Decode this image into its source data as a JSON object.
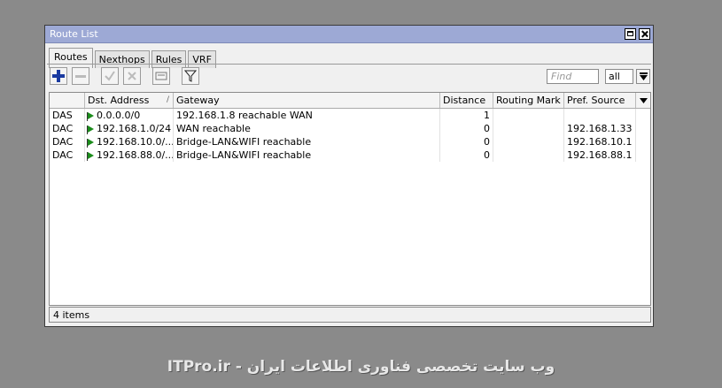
{
  "window": {
    "title": "Route List"
  },
  "tabs": [
    {
      "label": "Routes"
    },
    {
      "label": "Nexthops"
    },
    {
      "label": "Rules"
    },
    {
      "label": "VRF"
    }
  ],
  "toolbar": {
    "find_placeholder": "Find",
    "filter_value": "all"
  },
  "table": {
    "columns": [
      "",
      "Dst. Address",
      "Gateway",
      "Distance",
      "Routing Mark",
      "Pref. Source"
    ],
    "rows": [
      {
        "flags": "DAS",
        "dst": "0.0.0.0/0",
        "gateway": "192.168.1.8 reachable WAN",
        "distance": "1",
        "routing_mark": "",
        "pref_source": ""
      },
      {
        "flags": "DAC",
        "dst": "192.168.1.0/24",
        "gateway": "WAN reachable",
        "distance": "0",
        "routing_mark": "",
        "pref_source": "192.168.1.33"
      },
      {
        "flags": "DAC",
        "dst": "192.168.10.0/...",
        "gateway": "Bridge-LAN&WIFI reachable",
        "distance": "0",
        "routing_mark": "",
        "pref_source": "192.168.10.1"
      },
      {
        "flags": "DAC",
        "dst": "192.168.88.0/...",
        "gateway": "Bridge-LAN&WIFI reachable",
        "distance": "0",
        "routing_mark": "",
        "pref_source": "192.168.88.1"
      }
    ]
  },
  "status": {
    "count": "4 items"
  },
  "watermark": "ITPro.ir - وب سایت تخصصی فناوری اطلاعات ایران",
  "colors": {
    "titlebar": "#9da9d5",
    "flag": "#1b8c1b",
    "add_icon": "#1a3aa0"
  }
}
